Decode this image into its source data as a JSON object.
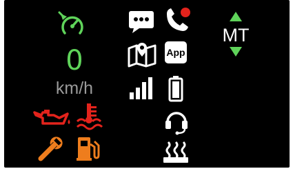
{
  "colors": {
    "background": "#000000",
    "ok_green": "#5fd35a",
    "warning_red": "#e3231c",
    "warning_orange": "#ee7d1d",
    "text_grey": "#9a9a9a",
    "white": "#ffffff"
  },
  "speed": {
    "value": "0",
    "unit": "km/h"
  },
  "gear": {
    "label": "MT"
  },
  "apps": {
    "app_label": "App"
  },
  "icons": [
    "cruise-control-icon",
    "oil-pressure-warning-icon",
    "coolant-temperature-warning-icon",
    "service-wrench-icon",
    "fuel-icon",
    "message-icon",
    "phone-call-icon",
    "map-icon",
    "signal-strength-icon",
    "battery-icon",
    "headset-icon",
    "rear-defrost-icon",
    "gear-up-arrow-icon",
    "gear-down-arrow-icon"
  ]
}
